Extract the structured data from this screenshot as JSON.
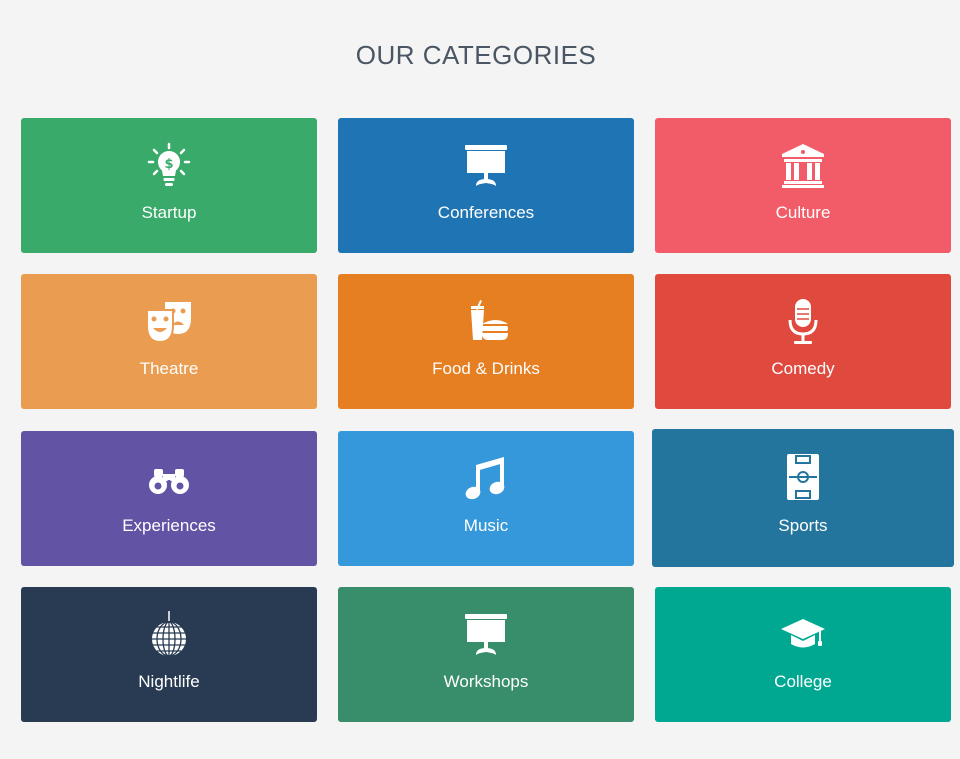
{
  "heading": "OUR CATEGORIES",
  "categories": [
    {
      "label": "Startup",
      "icon": "lightbulb-dollar-icon",
      "color": "#3aaa6b"
    },
    {
      "label": "Conferences",
      "icon": "presentation-board-icon",
      "color": "#1f75b4"
    },
    {
      "label": "Culture",
      "icon": "museum-building-icon",
      "color": "#f25c69"
    },
    {
      "label": "Theatre",
      "icon": "theatre-masks-icon",
      "color": "#ea9c51"
    },
    {
      "label": "Food & Drinks",
      "icon": "fast-food-icon",
      "color": "#e67e22"
    },
    {
      "label": "Comedy",
      "icon": "microphone-icon",
      "color": "#e04a3e"
    },
    {
      "label": "Experiences",
      "icon": "binoculars-icon",
      "color": "#6353a5"
    },
    {
      "label": "Music",
      "icon": "music-note-icon",
      "color": "#3498db"
    },
    {
      "label": "Sports",
      "icon": "soccer-field-icon",
      "color": "#23759e"
    },
    {
      "label": "Nightlife",
      "icon": "disco-ball-icon",
      "color": "#283b52"
    },
    {
      "label": "Workshops",
      "icon": "presentation-board-icon",
      "color": "#388d6a"
    },
    {
      "label": "College",
      "icon": "graduation-cap-icon",
      "color": "#00a892"
    }
  ]
}
